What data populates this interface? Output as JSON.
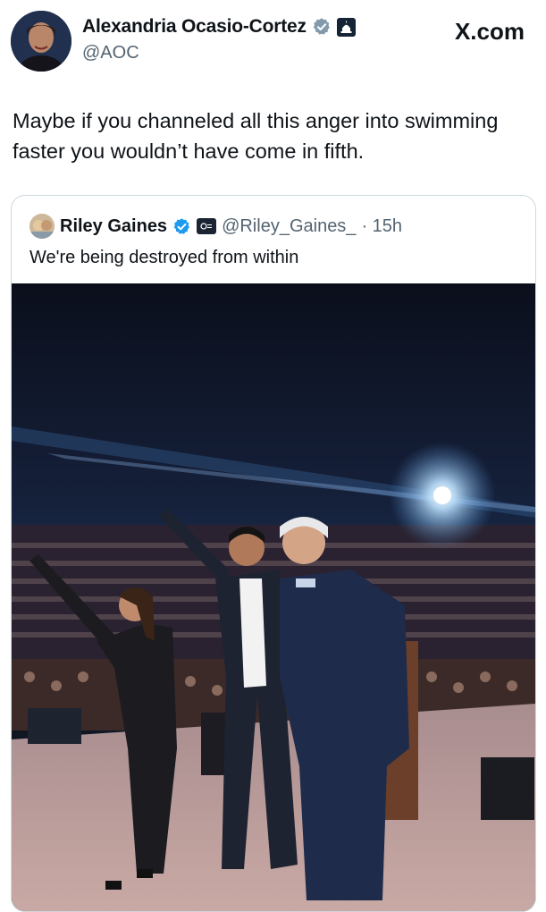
{
  "post": {
    "author_name": "Alexandria Ocasio-Cortez",
    "author_handle": "@AOC",
    "site_label": "X.com",
    "text": "Maybe if you channeled all this anger into swimming faster you wouldn’t have come in fifth.",
    "icons": [
      "verified-gray-badge-icon",
      "government-capitol-icon"
    ]
  },
  "quoted": {
    "author_name": "Riley Gaines",
    "author_handle": "@Riley_Gaines_",
    "time": "· 15h",
    "text": "We're being destroyed from within",
    "icons": [
      "verified-blue-badge-icon",
      "organization-logo-icon"
    ]
  },
  "colors": {
    "text": "#0f1419",
    "secondary": "#536471",
    "verified_blue": "#1d9bf0",
    "verified_gray": "#829aab",
    "border": "#cfd9de"
  }
}
